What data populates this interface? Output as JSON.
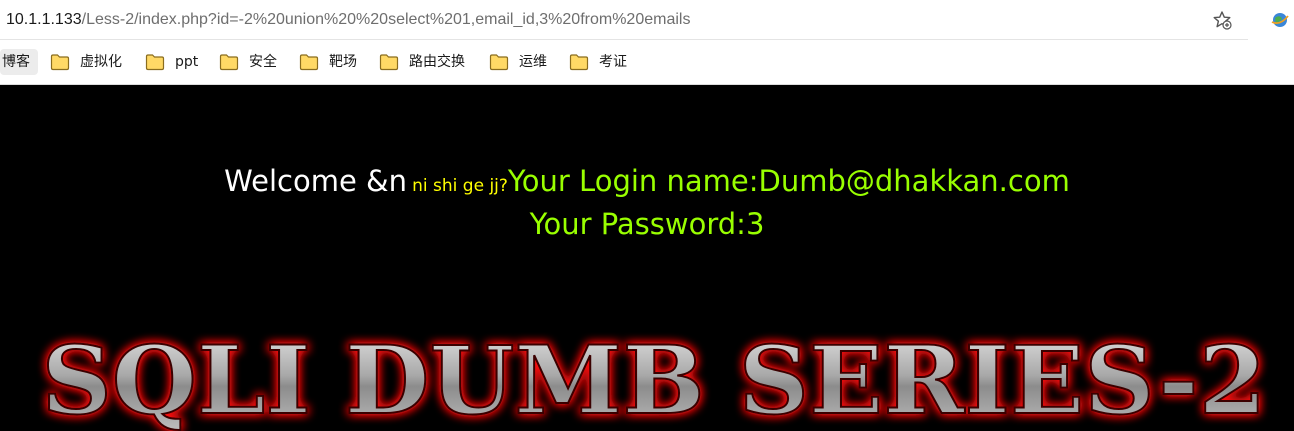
{
  "address_bar": {
    "url_host": "10.1.1.133",
    "url_path": "/Less-2/index.php?id=-2%20union%20%20select%201,email_id,3%20from%20emails",
    "star_icon": "bookmark-star-icon",
    "extension_icon": "globe-extension-icon"
  },
  "bookmarks": {
    "first_label": "博客",
    "items": [
      {
        "label": "虚拟化",
        "icon": "folder-icon"
      },
      {
        "label": "ppt",
        "icon": "folder-icon"
      },
      {
        "label": "安全",
        "icon": "folder-icon"
      },
      {
        "label": "靶场",
        "icon": "folder-icon"
      },
      {
        "label": "路由交换",
        "icon": "folder-icon"
      },
      {
        "label": "运维",
        "icon": "folder-icon"
      },
      {
        "label": "考证",
        "icon": "folder-icon"
      }
    ]
  },
  "page": {
    "welcome": "Welcome &n",
    "alias": "ni shi ge jj?",
    "login_name": "Your Login name:Dumb@dhakkan.com",
    "password": "Your Password:3",
    "banner": "SQLI DUMB SERIES-2"
  },
  "colors": {
    "background": "#000000",
    "welcome": "#ffffff",
    "alias": "#ffff00",
    "result": "#99ff00",
    "banner_glow": "#ff0000"
  }
}
